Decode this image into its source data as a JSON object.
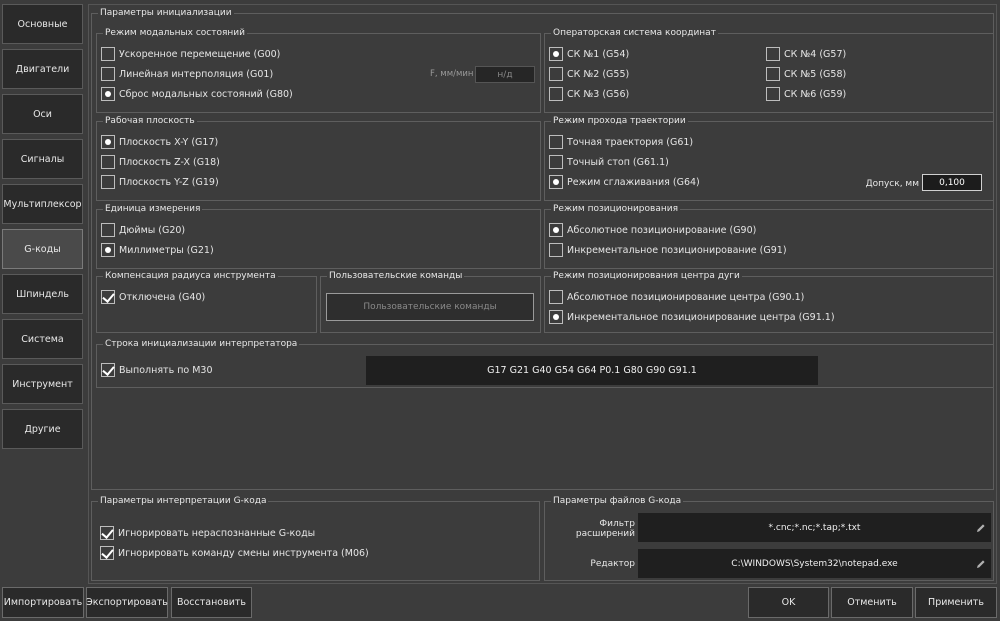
{
  "sidebar": {
    "items": [
      {
        "label": "Основные"
      },
      {
        "label": "Двигатели"
      },
      {
        "label": "Оси"
      },
      {
        "label": "Сигналы"
      },
      {
        "label": "Мультиплексор"
      },
      {
        "label": "G-коды"
      },
      {
        "label": "Шпиндель"
      },
      {
        "label": "Система"
      },
      {
        "label": "Инструмент"
      },
      {
        "label": "Другие"
      }
    ],
    "active": "G-коды"
  },
  "init": {
    "title": "Параметры инициализации",
    "modal": {
      "title": "Режим модальных состояний",
      "options": [
        {
          "label": "Ускоренное перемещение (G00)",
          "checked": false
        },
        {
          "label": "Линейная интерполяция (G01)",
          "checked": false
        },
        {
          "label": "Сброс модальных состояний (G80)",
          "checked": true
        }
      ],
      "feed_label": "F, мм/мин",
      "feed_placeholder": "н/д"
    },
    "coords": {
      "title": "Операторская система координат",
      "options": [
        {
          "label": "СК №1 (G54)",
          "checked": true
        },
        {
          "label": "СК №2 (G55)",
          "checked": false
        },
        {
          "label": "СК №3 (G56)",
          "checked": false
        },
        {
          "label": "СК №4 (G57)",
          "checked": false
        },
        {
          "label": "СК №5 (G58)",
          "checked": false
        },
        {
          "label": "СК №6 (G59)",
          "checked": false
        }
      ]
    },
    "plane": {
      "title": "Рабочая плоскость",
      "options": [
        {
          "label": "Плоскость X-Y (G17)",
          "checked": true
        },
        {
          "label": "Плоскость Z-X (G18)",
          "checked": false
        },
        {
          "label": "Плоскость Y-Z (G19)",
          "checked": false
        }
      ]
    },
    "path": {
      "title": "Режим прохода траектории",
      "options": [
        {
          "label": "Точная траектория (G61)",
          "checked": false
        },
        {
          "label": "Точный стоп (G61.1)",
          "checked": false
        },
        {
          "label": "Режим сглаживания (G64)",
          "checked": true
        }
      ],
      "tolerance_label": "Допуск, мм",
      "tolerance_value": "0,100"
    },
    "units": {
      "title": "Единица измерения",
      "options": [
        {
          "label": "Дюймы (G20)",
          "checked": false
        },
        {
          "label": "Миллиметры (G21)",
          "checked": true
        }
      ]
    },
    "positioning": {
      "title": "Режим позиционирования",
      "options": [
        {
          "label": "Абсолютное позиционирование (G90)",
          "checked": true
        },
        {
          "label": "Инкрементальное позиционирование (G91)",
          "checked": false
        }
      ]
    },
    "radius": {
      "title": "Компенсация радиуса инструмента",
      "option": {
        "label": "Отключена (G40)",
        "checked": true
      }
    },
    "custom": {
      "title": "Пользовательские команды",
      "button": "Пользовательские команды"
    },
    "arc": {
      "title": "Режим позиционирования центра дуги",
      "options": [
        {
          "label": "Абсолютное позиционирование центра (G90.1)",
          "checked": false
        },
        {
          "label": "Инкрементальное позиционирование центра (G91.1)",
          "checked": true
        }
      ]
    },
    "init_string": {
      "title": "Строка инициализации интерпретатора",
      "option": {
        "label": "Выполнять по M30",
        "checked": true
      },
      "value": "G17 G21 G40 G54 G64 P0.1 G80 G90 G91.1"
    }
  },
  "interp": {
    "title": "Параметры интерпретации G-кода",
    "options": [
      {
        "label": "Игнорировать нераспознанные G-коды",
        "checked": true
      },
      {
        "label": "Игнорировать команду смены инструмента (M06)",
        "checked": true
      }
    ]
  },
  "files": {
    "title": "Параметры файлов G-кода",
    "filter_label": "Фильтр расширений",
    "filter_value": "*.cnc;*.nc;*.tap;*.txt",
    "editor_label": "Редактор",
    "editor_value": "C:\\WINDOWS\\System32\\notepad.exe"
  },
  "footer": {
    "import": "Импортировать",
    "export": "Экспортировать",
    "restore": "Восстановить",
    "ok": "OK",
    "cancel": "Отменить",
    "apply": "Применить"
  },
  "icons": {
    "edit": "pencil-icon"
  }
}
